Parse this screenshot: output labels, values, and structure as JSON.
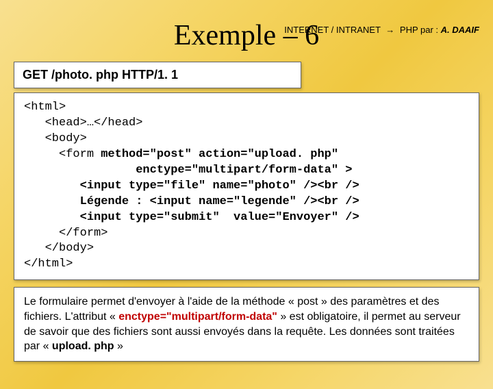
{
  "header": {
    "left": "INTERNET / INTRANET",
    "arrow": "→",
    "right_prefix": "PHP par : ",
    "author": "A. DAAIF"
  },
  "title": "Exemple – 6",
  "request_line": "GET  /photo. php HTTP/1. 1",
  "code": {
    "l1": "<html>",
    "l2": "   <head>…</head>",
    "l3": "   <body>",
    "l4a": "     <form ",
    "l4b": "method=\"post\" action=\"upload. php\"",
    "l5": "                enctype=\"multipart/form-data\" >",
    "l6": "        <input type=\"file\" name=\"photo\" /><br />",
    "l7": "        Légende : <input name=\"legende\" /><br />",
    "l8": "        <input type=\"submit\"  value=\"Envoyer\" />",
    "l9": "     </form>",
    "l10": "   </body>",
    "l11": "</html>"
  },
  "description": {
    "p1a": "Le formulaire permet d'envoyer à l'aide de la méthode « post » des paramètres et des fichiers. L'attribut « ",
    "p1_red": "enctype=\"multipart/form-data\"",
    "p1b": " » est obligatoire, il permet au serveur de savoir que des fichiers sont aussi envoyés dans la requête. Les données sont traitées par « ",
    "p1c_bold": "upload. php",
    "p1d": " »"
  }
}
